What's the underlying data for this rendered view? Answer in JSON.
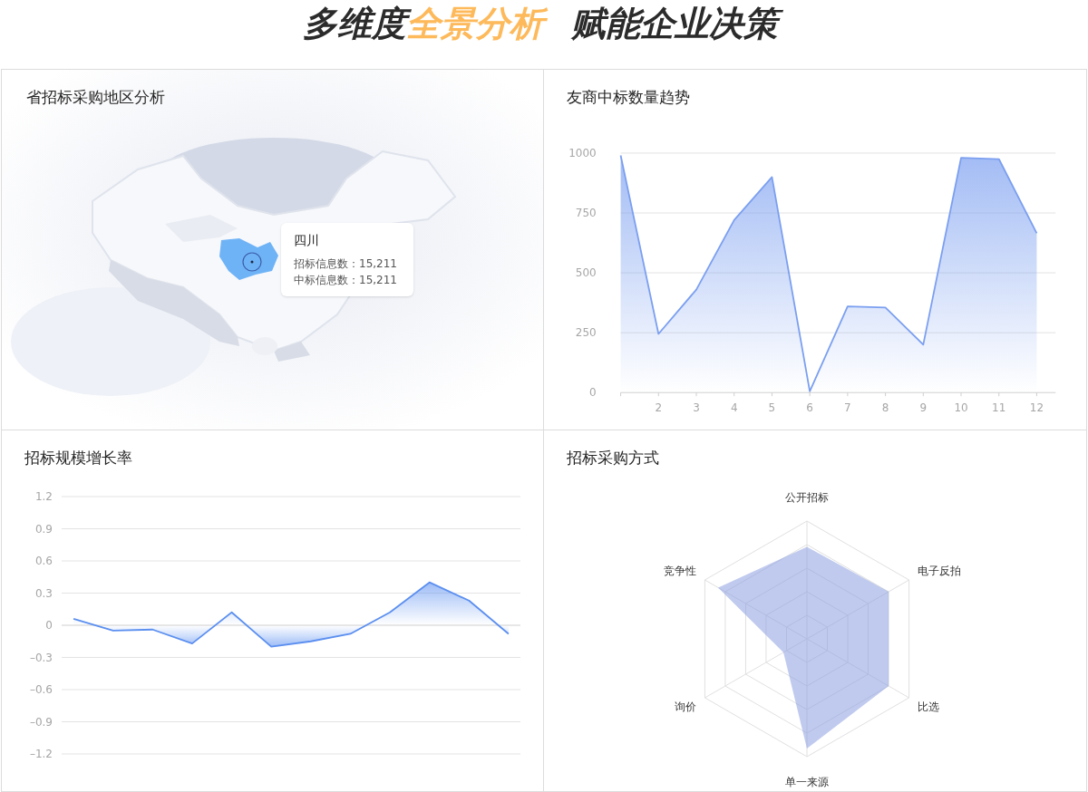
{
  "headline": {
    "groups": [
      [
        {
          "text": "多维度",
          "accent": false
        },
        {
          "text": "全景分析",
          "accent": true
        }
      ],
      [
        {
          "text": "赋能企业决策",
          "accent": false
        }
      ]
    ]
  },
  "panels": [
    {
      "kind": "map",
      "title": "省招标采购地区分析",
      "tooltip": {
        "title": "四川",
        "lines": [
          "招标信息数：15,211",
          "中标信息数：15,211"
        ]
      }
    },
    {
      "kind": "area",
      "title": "友商中标数量趋势",
      "chart_data": {
        "type": "area",
        "x": [
          1,
          2,
          3,
          4,
          5,
          6,
          7,
          8,
          9,
          10,
          11,
          12
        ],
        "grid": true,
        "series": [
          {
            "color": "#7b9ff0",
            "values": [
              990,
              245,
              430,
              720,
              900,
              5,
              360,
              355,
              200,
              980,
              975,
              665
            ]
          }
        ],
        "xlim": [
          1,
          12.5
        ],
        "ylim": [
          0,
          1000
        ],
        "xticks": [
          2,
          3,
          4,
          5,
          6,
          7,
          8,
          9,
          10,
          11,
          12
        ],
        "yticks": [
          0,
          250,
          500,
          750,
          1000
        ]
      }
    },
    {
      "kind": "area",
      "title": "招标规模增长率",
      "chart_data": {
        "type": "area",
        "categories": [
          null,
          null,
          null,
          null,
          null,
          null,
          null,
          null,
          null,
          null,
          null,
          null
        ],
        "grid": true,
        "series": [
          {
            "color": "#5b8ff0",
            "values": [
              0.06,
              -0.05,
              -0.04,
              -0.17,
              0.12,
              -0.2,
              -0.15,
              -0.08,
              0.12,
              0.4,
              0.23,
              -0.08
            ]
          }
        ],
        "ylim": [
          -1.2,
          1.2
        ],
        "yticks": [
          {
            "value": -1.2,
            "label": "–1.2"
          },
          {
            "value": -0.9,
            "label": "–0.9"
          },
          {
            "value": -0.6,
            "label": "–0.6"
          },
          {
            "value": -0.3,
            "label": "–0.3"
          },
          {
            "value": 0,
            "label": "0"
          },
          {
            "value": 0.3,
            "label": "0.3"
          },
          {
            "value": 0.6,
            "label": "0.6"
          },
          {
            "value": 0.9,
            "label": "0.9"
          },
          {
            "value": 1.2,
            "label": "1.2"
          }
        ]
      }
    },
    {
      "kind": "radar",
      "title": "招标采购方式",
      "axes": [
        "公开招标",
        "电子反拍",
        "比选",
        "单一来源",
        "询价",
        "竞争性"
      ]
    }
  ]
}
